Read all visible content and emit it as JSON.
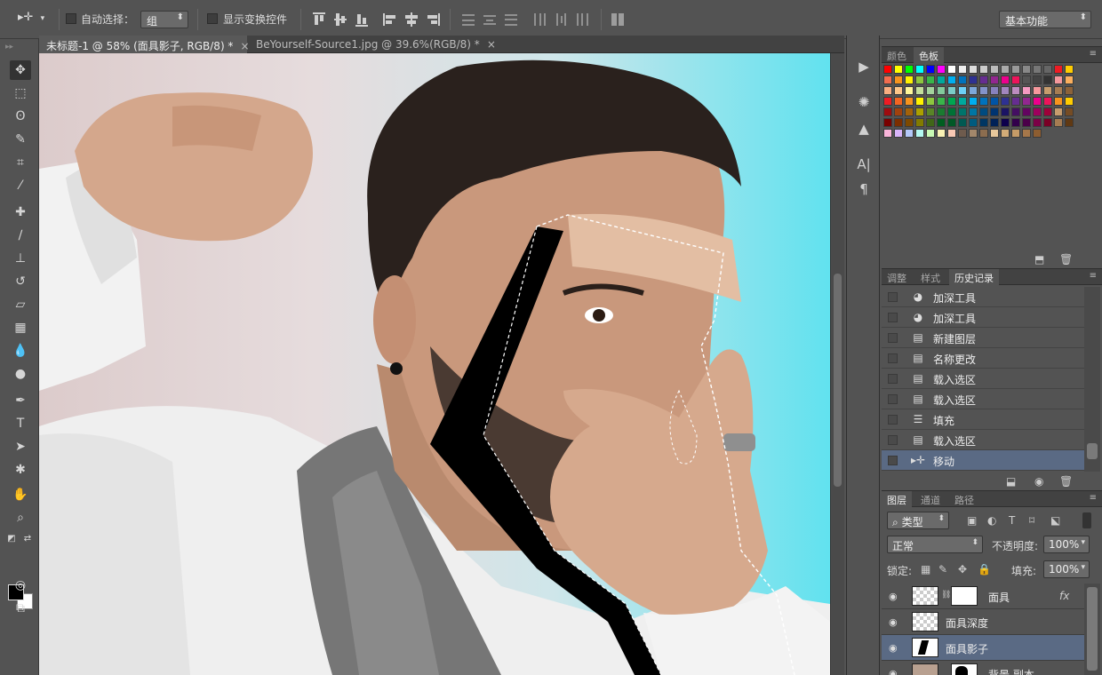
{
  "options_bar": {
    "auto_select_label": "自动选择：",
    "auto_select_value": "组",
    "show_transform_label": "显示变换控件",
    "workspace_value": "基本功能"
  },
  "tabs": [
    {
      "label": "未标题-1 @ 58% (面具影子, RGB/8) *"
    },
    {
      "label": "BeYourself-Source1.jpg @ 39.6%(RGB/8) *"
    }
  ],
  "swatches_panel": {
    "tabs": [
      "颜色",
      "色板"
    ],
    "colors": [
      "#ff0000",
      "#ffff00",
      "#00ff00",
      "#00ffff",
      "#0000ff",
      "#ff00ff",
      "#ffffff",
      "#eeeeee",
      "#dddddd",
      "#cccccc",
      "#bbbbbb",
      "#aaaaaa",
      "#999999",
      "#888888",
      "#777777",
      "#666666",
      "#ee1c24",
      "#ffcc00",
      "#f26c4f",
      "#f7941d",
      "#fff200",
      "#8dc63f",
      "#39b54a",
      "#00a99d",
      "#00aeef",
      "#0072bc",
      "#2e3192",
      "#662d91",
      "#92278f",
      "#ec008c",
      "#ed145b",
      "#555555",
      "#444444",
      "#333333",
      "#f5989d",
      "#fbaf5d",
      "#f9ad81",
      "#fdc689",
      "#fff799",
      "#c4df9b",
      "#a3d39c",
      "#82ca9c",
      "#7accc8",
      "#6dcff6",
      "#7da7d9",
      "#8393ca",
      "#8781bd",
      "#a186be",
      "#bd8cbf",
      "#f49ac1",
      "#f6989d",
      "#c69c6d",
      "#a67c52",
      "#8c6239",
      "#ed1c24",
      "#f26522",
      "#f7941d",
      "#fff200",
      "#8dc63f",
      "#39b54a",
      "#00a651",
      "#00a99d",
      "#00aeef",
      "#0072bc",
      "#0054a6",
      "#2e3192",
      "#662d91",
      "#92278f",
      "#ec008c",
      "#ed145b",
      "#f7941d",
      "#ffcc00",
      "#9e0b0f",
      "#a0410d",
      "#a36209",
      "#aba000",
      "#598527",
      "#1a7b30",
      "#007236",
      "#00746b",
      "#0076a3",
      "#004b80",
      "#003471",
      "#1b1464",
      "#440e62",
      "#630460",
      "#9e005d",
      "#9e0039",
      "#c69c6d",
      "#754c24",
      "#790000",
      "#7b2e00",
      "#7d4900",
      "#827b00",
      "#406618",
      "#005e20",
      "#005826",
      "#005952",
      "#005b7f",
      "#003663",
      "#002157",
      "#0d004c",
      "#32004b",
      "#4b0049",
      "#7b0046",
      "#7a0026",
      "#a67c52",
      "#603913",
      "#f9b4d9",
      "#d8b4f9",
      "#b4c8f9",
      "#b4f9f1",
      "#c9f9b4",
      "#f9f1b4",
      "#f9c9b4",
      "#6e5b4d",
      "#a2876b",
      "#8c6d4f",
      "#e7c79b",
      "#d3ac78",
      "#c59b67",
      "#a5774a",
      "#8c5d31"
    ]
  },
  "history_panel": {
    "tabs": [
      "调整",
      "样式",
      "历史记录"
    ],
    "items": [
      {
        "label": "加深工具",
        "icon": "burn-tool-icon"
      },
      {
        "label": "加深工具",
        "icon": "burn-tool-icon"
      },
      {
        "label": "新建图层",
        "icon": "document-icon"
      },
      {
        "label": "名称更改",
        "icon": "document-icon"
      },
      {
        "label": "载入选区",
        "icon": "document-icon"
      },
      {
        "label": "载入选区",
        "icon": "document-icon"
      },
      {
        "label": "填充",
        "icon": "fill-icon"
      },
      {
        "label": "载入选区",
        "icon": "document-icon"
      },
      {
        "label": "移动",
        "icon": "move-tool-icon"
      }
    ]
  },
  "layers_panel": {
    "tabs": [
      "图层",
      "通道",
      "路径"
    ],
    "filter_value": "类型",
    "blend_mode": "正常",
    "opacity_label": "不透明度:",
    "opacity_value": "100%",
    "lock_label": "锁定:",
    "fill_label": "填充:",
    "fill_value": "100%",
    "fx_label": "fx",
    "layers": [
      {
        "name": "面具"
      },
      {
        "name": "面具深度"
      },
      {
        "name": "面具影子"
      },
      {
        "name": "背景 副本"
      }
    ]
  },
  "toolbar": {
    "tools": [
      "move-tool",
      "marquee-tool",
      "lasso-tool",
      "quick-select-tool",
      "crop-tool",
      "eyedropper-tool",
      "healing-brush-tool",
      "brush-tool",
      "stamp-tool",
      "history-brush-tool",
      "eraser-tool",
      "gradient-tool",
      "blur-tool",
      "dodge-tool",
      "pen-tool",
      "type-tool",
      "path-select-tool",
      "shape-tool",
      "hand-tool",
      "zoom-tool"
    ],
    "type_glyph": "T"
  },
  "strip": {
    "text_glyph": "A|",
    "para_glyph": "¶"
  }
}
